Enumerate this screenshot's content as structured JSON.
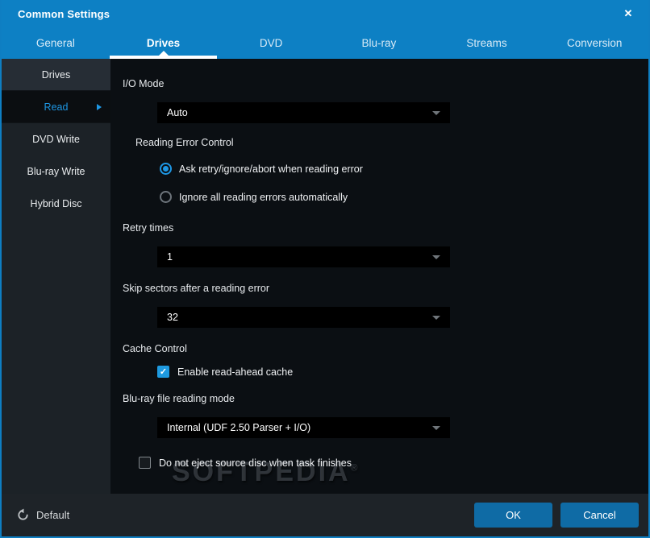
{
  "window": {
    "title": "Common Settings",
    "close_glyph": "✕"
  },
  "colors": {
    "header_blue": "#0d80c4",
    "accent_blue": "#1e97e4",
    "button_blue": "#0f6ba5",
    "content_bg": "#0b0f13",
    "sidebar_bg": "#1c2227"
  },
  "tabs": [
    {
      "label": "General",
      "active": false
    },
    {
      "label": "Drives",
      "active": true
    },
    {
      "label": "DVD",
      "active": false
    },
    {
      "label": "Blu-ray",
      "active": false
    },
    {
      "label": "Streams",
      "active": false
    },
    {
      "label": "Conversion",
      "active": false
    }
  ],
  "sidebar": {
    "items": [
      {
        "label": "Drives",
        "state": "parent"
      },
      {
        "label": "Read",
        "state": "active"
      },
      {
        "label": "DVD Write",
        "state": "normal"
      },
      {
        "label": "Blu-ray Write",
        "state": "normal"
      },
      {
        "label": "Hybrid Disc",
        "state": "normal"
      }
    ]
  },
  "content": {
    "io_mode": {
      "label": "I/O Mode",
      "value": "Auto"
    },
    "reading_error_control": {
      "label": "Reading Error Control",
      "options": [
        {
          "label": "Ask retry/ignore/abort when reading error",
          "selected": true
        },
        {
          "label": "Ignore all reading errors automatically",
          "selected": false
        }
      ]
    },
    "retry_times": {
      "label": "Retry times",
      "value": "1"
    },
    "skip_sectors": {
      "label": "Skip sectors after a reading error",
      "value": "32"
    },
    "cache_control": {
      "label": "Cache Control",
      "checkbox_label": "Enable read-ahead cache",
      "checked": true,
      "check_glyph": "✓"
    },
    "bluray_mode": {
      "label": "Blu-ray file reading mode",
      "value": "Internal (UDF 2.50 Parser + I/O)"
    },
    "eject_option": {
      "label": "Do not eject source disc when task finishes",
      "checked": false
    },
    "watermark": {
      "text": "SOFTPEDIA",
      "mark": "®"
    }
  },
  "footer": {
    "default_label": "Default",
    "ok_label": "OK",
    "cancel_label": "Cancel"
  }
}
